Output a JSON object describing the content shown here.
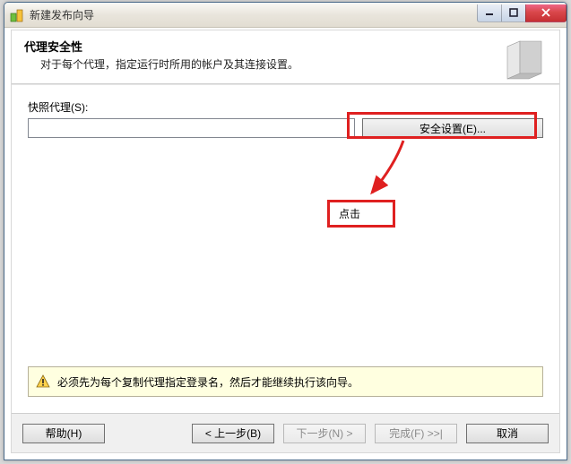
{
  "window": {
    "title": "新建发布向导"
  },
  "header": {
    "title": "代理安全性",
    "subtitle": "对于每个代理，指定运行时所用的帐户及其连接设置。"
  },
  "body": {
    "snapshot_label": "快照代理(S):",
    "snapshot_value": "",
    "security_button": "安全设置(E)..."
  },
  "annotation": {
    "hint": "点击"
  },
  "warning": {
    "text": "必须先为每个复制代理指定登录名，然后才能继续执行该向导。"
  },
  "footer": {
    "help": "帮助(H)",
    "back": "< 上一步(B)",
    "next": "下一步(N) >",
    "finish": "完成(F) >>|",
    "cancel": "取消"
  }
}
